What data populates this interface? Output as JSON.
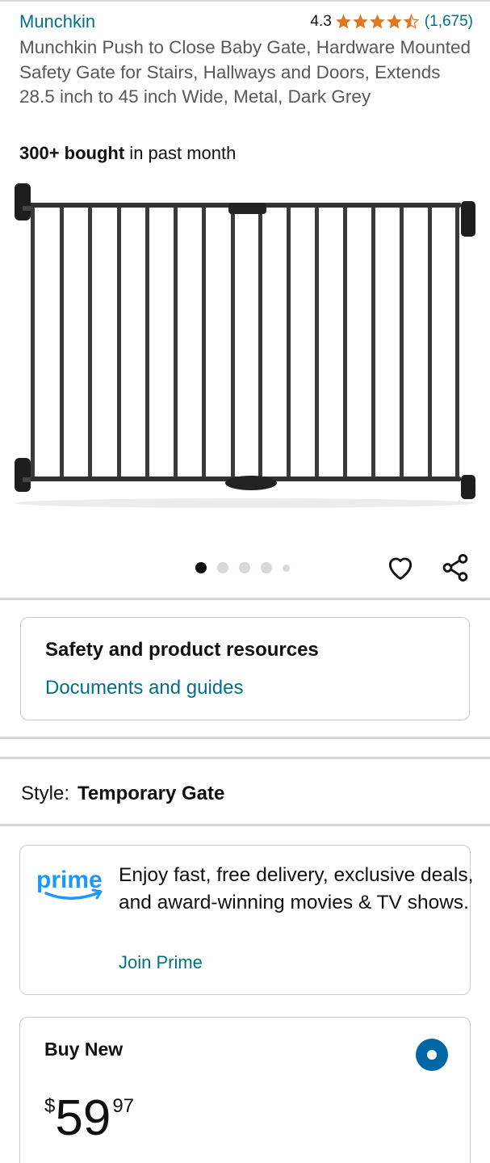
{
  "product": {
    "brand": "Munchkin",
    "rating": "4.3",
    "rating_count": "(1,675)",
    "title": "Munchkin Push to Close Baby Gate, Hardware Mounted Safety Gate for Stairs, Hallways and Doors, Extends 28.5 inch to 45 inch Wide, Metal, Dark Grey",
    "bought_bold": "300+ bought",
    "bought_rest": " in past month",
    "star_fill": [
      1,
      1,
      1,
      1,
      0.5
    ]
  },
  "gallery": {
    "image_count": 5,
    "active_index": 0
  },
  "safety": {
    "title": "Safety and product resources",
    "link": "Documents and guides"
  },
  "style": {
    "label": "Style:",
    "value": "Temporary Gate"
  },
  "prime": {
    "logo_text": "prime",
    "text": "Enjoy fast, free delivery, exclusive deals, and award-winning movies & TV shows.",
    "link": "Join Prime"
  },
  "buy": {
    "title": "Buy New",
    "currency": "$",
    "whole": "59",
    "fraction": "97",
    "selected": true
  },
  "colors": {
    "link": "#007185",
    "star": "#de7921",
    "radio": "#0066a4",
    "prime_blue": "#1a98ff"
  }
}
